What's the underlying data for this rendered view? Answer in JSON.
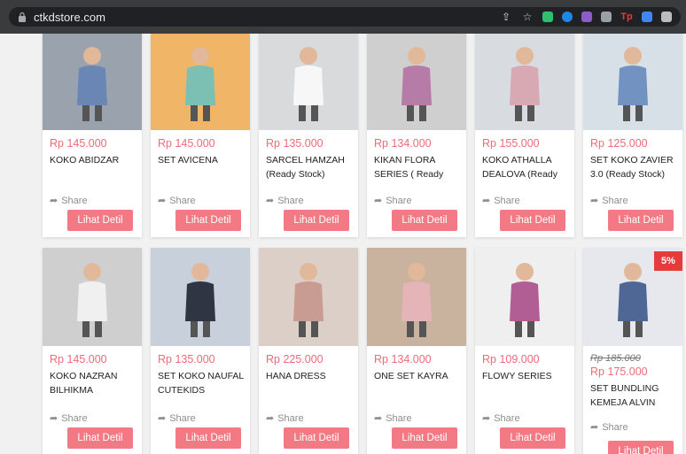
{
  "browser": {
    "url": "ctkdstore.com",
    "icons": [
      "share-icon",
      "star-icon",
      "extension-icons"
    ]
  },
  "products_row1": [
    {
      "price": "Rp 145.000",
      "name": "KOKO ABIDZAR",
      "share": "Share",
      "button": "Lihat Detil",
      "bg": "#9aa3ad",
      "fig": "#6a86b4"
    },
    {
      "price": "Rp 145.000",
      "name": "SET AVICENA",
      "share": "Share",
      "button": "Lihat Detil",
      "bg": "#f1b567",
      "fig": "#7bc0b2"
    },
    {
      "price": "Rp 135.000",
      "name": "SARCEL HAMZAH (Ready Stock)",
      "share": "Share",
      "button": "Lihat Detil",
      "bg": "#d9dadc",
      "fig": "#f7f7f7"
    },
    {
      "price": "Rp 134.000",
      "name": "KIKAN FLORA SERIES ( Ready",
      "share": "Share",
      "button": "Lihat Detil",
      "bg": "#cfcfcf",
      "fig": "#b67ba6"
    },
    {
      "price": "Rp 155.000",
      "name": "KOKO ATHALLA DEALOVA (Ready",
      "share": "Share",
      "button": "Lihat Detil",
      "bg": "#d8dbe0",
      "fig": "#d8a9b2"
    },
    {
      "price": "Rp 125.000",
      "name": "SET KOKO ZAVIER 3.0 (Ready Stock)",
      "share": "Share",
      "button": "Lihat Detil",
      "bg": "#d7dfe7",
      "fig": "#7292c1"
    }
  ],
  "products_row2": [
    {
      "price": "Rp 145.000",
      "name": "KOKO NAZRAN BILHIKMA",
      "share": "Share",
      "button": "Lihat Detil",
      "bg": "#cfcfcf",
      "fig": "#f0f0f0"
    },
    {
      "price": "Rp 135.000",
      "name": "SET KOKO NAUFAL CUTEKIDS",
      "share": "Share",
      "button": "Lihat Detil",
      "bg": "#c7d0db",
      "fig": "#2f3542"
    },
    {
      "price": "Rp 225.000",
      "name": "HANA DRESS",
      "share": "Share",
      "button": "Lihat Detil",
      "bg": "#dccfc8",
      "fig": "#c99c93"
    },
    {
      "price": "Rp 134.000",
      "name": "ONE SET KAYRA",
      "share": "Share",
      "button": "Lihat Detil",
      "bg": "#c9b29e",
      "fig": "#e5b4b9"
    },
    {
      "price": "Rp 109.000",
      "name": "FLOWY SERIES",
      "share": "Share",
      "button": "Lihat Detil",
      "bg": "#efefef",
      "fig": "#b05e93"
    },
    {
      "old_price": "Rp 185.000",
      "price": "Rp 175.000",
      "name": "SET BUNDLING KEMEJA ALVIN",
      "share": "Share",
      "button": "Lihat Detil",
      "badge": "5%",
      "bg": "#e6e8ed",
      "fig": "#4f6794"
    }
  ]
}
